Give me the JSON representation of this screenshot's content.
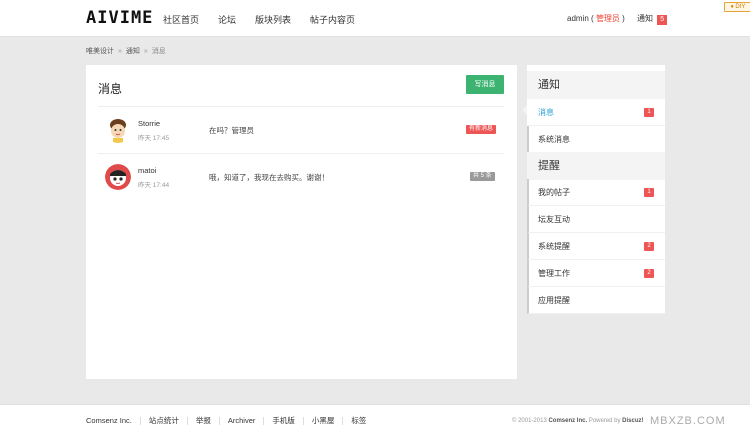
{
  "header": {
    "logo": "AIVIME",
    "nav": [
      "社区首页",
      "论坛",
      "版块列表",
      "帖子内容页"
    ],
    "user_name": "admin",
    "user_role_open": "(",
    "user_role": "管理员",
    "user_role_close": ")",
    "notice_label": "通知",
    "notice_count": "5",
    "diy_label": "♦ DIY"
  },
  "breadcrumb": {
    "items": [
      "唯美设计",
      "通知",
      "消息"
    ],
    "separator": "»"
  },
  "main": {
    "title": "消息",
    "write_button": "写消息",
    "messages": [
      {
        "name": "Storrie",
        "time": "昨天 17:45",
        "text": "在吗？管理员",
        "tag": "有新消息",
        "tag_color": "#e55555"
      },
      {
        "name": "matoi",
        "time": "昨天 17:44",
        "text": "哦，知道了，我现在去购买。谢谢！",
        "tag": "共 5 条",
        "tag_color": "#9a9a9a"
      }
    ]
  },
  "sidebar": {
    "notice_head": "通知",
    "notice_items": [
      {
        "label": "消息",
        "badge": "1",
        "active": true
      },
      {
        "label": "系统消息",
        "badge": ""
      }
    ],
    "remind_head": "提醒",
    "remind_items": [
      {
        "label": "我的帖子",
        "badge": "1"
      },
      {
        "label": "坛友互动",
        "badge": ""
      },
      {
        "label": "系统提醒",
        "badge": "2"
      },
      {
        "label": "管理工作",
        "badge": "2"
      },
      {
        "label": "应用提醒",
        "badge": ""
      }
    ],
    "active_color": "#2a9fd6"
  },
  "footer": {
    "links": [
      "Comsenz Inc.",
      "站点统计",
      "举报",
      "Archiver",
      "手机版",
      "小黑屋",
      "标签"
    ],
    "copyright_prefix": "© 2001-2013",
    "copyright_company": "Comsenz Inc.",
    "powered_by": "Powered by",
    "powered_name": "Discuz!",
    "watermark": "MBXZB.COM"
  },
  "colors": {
    "accent_green": "#3cb371",
    "badge_red": "#e55555"
  }
}
